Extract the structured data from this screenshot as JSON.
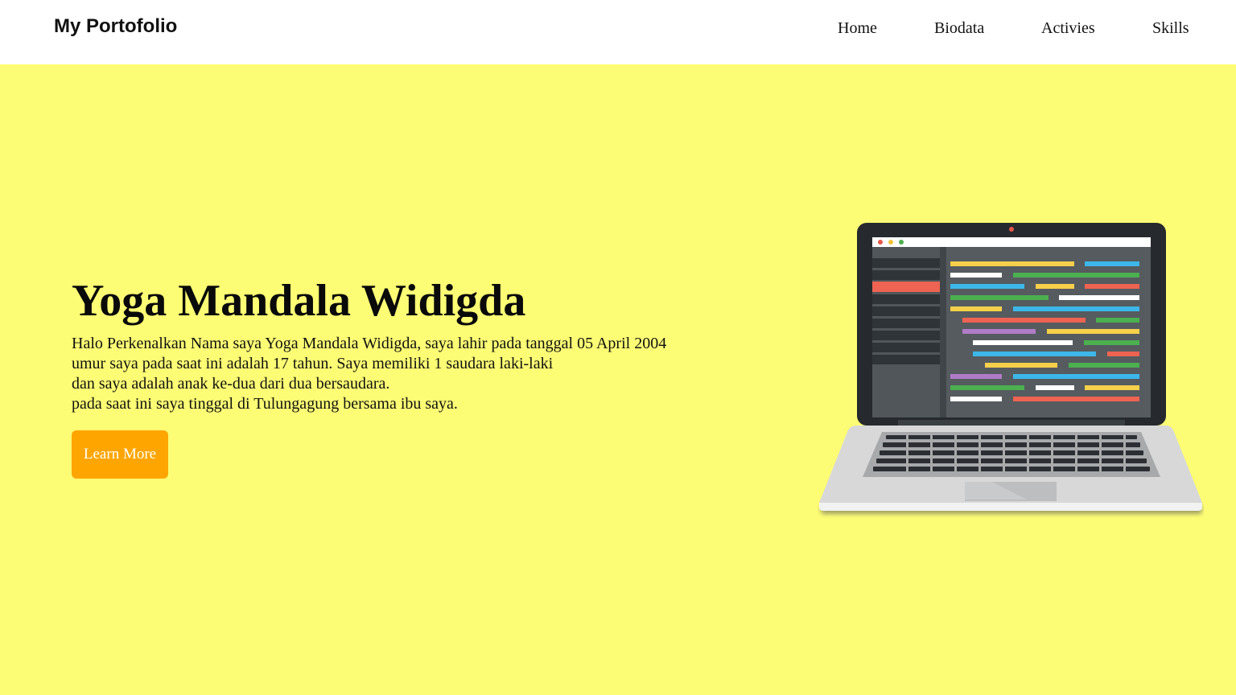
{
  "navbar": {
    "brand": "My Portofolio",
    "items": [
      {
        "label": "Home"
      },
      {
        "label": "Biodata"
      },
      {
        "label": "Activies"
      },
      {
        "label": "Skills"
      }
    ]
  },
  "hero": {
    "title": "Yoga Mandala Widigda",
    "lines": [
      "Halo Perkenalkan Nama saya Yoga Mandala Widigda, saya lahir pada tanggal 05 April 2004",
      "umur saya pada saat ini adalah 17 tahun. Saya memiliki 1 saudara laki-laki",
      "dan saya adalah anak ke-dua dari dua bersaudara.",
      "pada saat ini saya tinggal di Tulungagung bersama ibu saya."
    ],
    "button_label": "Learn More"
  },
  "colors": {
    "hero_background": "#fdfd75",
    "button_background": "#ffa500",
    "navbar_background": "#ffffff"
  },
  "illustration": {
    "icon": "laptop-code-icon"
  }
}
